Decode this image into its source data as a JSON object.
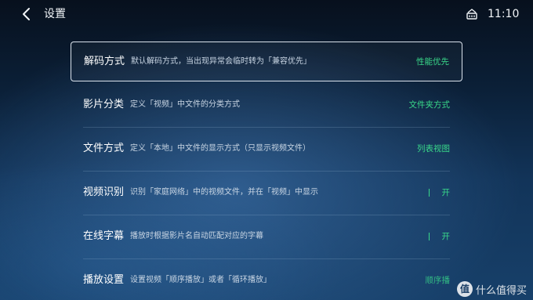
{
  "header": {
    "title": "设置",
    "clock": "11:10"
  },
  "settings": [
    {
      "label": "解码方式",
      "desc": "默认解码方式，当出现异常会临时转为「兼容优先」",
      "value": "性能优先"
    },
    {
      "label": "影片分类",
      "desc": "定义「视频」中文件的分类方式",
      "value": "文件夹方式"
    },
    {
      "label": "文件方式",
      "desc": "定义「本地」中文件的显示方式（只显示视频文件）",
      "value": "列表视图"
    },
    {
      "label": "视频识别",
      "desc": "识别「家庭网络」中的视频文件，并在「视频」中显示",
      "value": "开"
    },
    {
      "label": "在线字幕",
      "desc": "播放时根据影片名自动匹配对应的字幕",
      "value": "开"
    },
    {
      "label": "播放设置",
      "desc": "设置视频「顺序播放」或者「循环播放」",
      "value": "顺序播"
    }
  ],
  "watermark": {
    "badge": "值",
    "text": "什么值得买"
  },
  "colors": {
    "accent": "#39d98a",
    "selection_border": "#ebf3fc"
  }
}
